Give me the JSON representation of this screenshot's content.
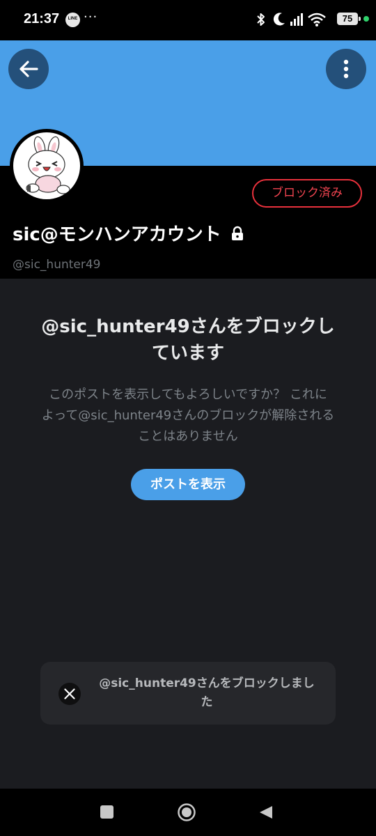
{
  "status_bar": {
    "time": "21:37",
    "more": "···",
    "battery": "75",
    "icons": [
      "line-icon",
      "bluetooth-icon",
      "moon-icon",
      "signal-icon",
      "wifi-icon",
      "battery-icon"
    ]
  },
  "colors": {
    "banner": "#4a9fe8",
    "blocked_red": "#e8313c",
    "accent_blue": "#4a9fe8",
    "background": "#1b1c20"
  },
  "header": {
    "back_icon": "arrow-left-icon",
    "menu_icon": "vertical-dots-icon"
  },
  "profile": {
    "display_name": "sic@モンハンアカウント",
    "handle": "@sic_hunter49",
    "blocked_button": "ブロック済み",
    "lock_icon": "lock-icon",
    "avatar": "cony-rabbit-avatar"
  },
  "block_message": {
    "title_line1": "@sic_hunter49さんをブロックし",
    "title_line2": "ています",
    "desc_line1": "このポストを表示してもよろしいですか？ これに",
    "desc_line2": "よって@sic_hunter49さんのブロックが解除される",
    "desc_line3": "ことはありません",
    "show_post_button": "ポストを表示"
  },
  "toast": {
    "line1": "@sic_hunter49さんをブロックしまし",
    "line2": "た",
    "icon": "x-logo-icon"
  },
  "nav_bar": {
    "icons": [
      "recents-icon",
      "home-icon",
      "back-icon"
    ]
  }
}
